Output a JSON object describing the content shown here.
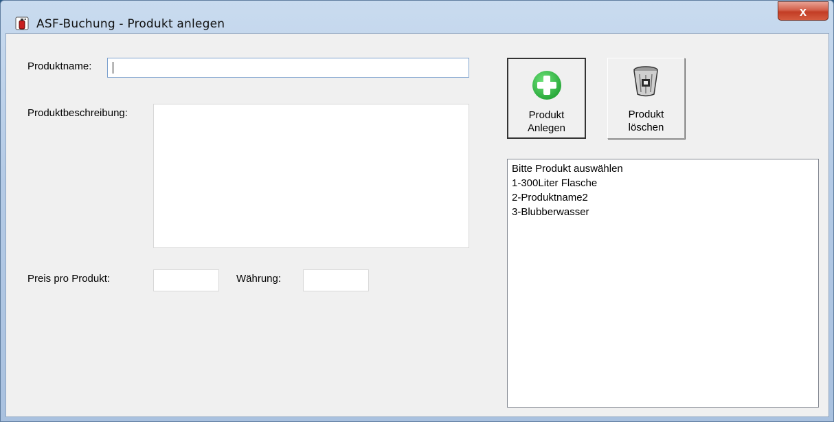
{
  "window": {
    "title": "ASF-Buchung - Produkt anlegen",
    "close_label": "x"
  },
  "form": {
    "name_label": "Produktname:",
    "description_label": "Produktbeschreibung:",
    "price_label": "Preis pro Produkt:",
    "currency_label": "Währung:"
  },
  "buttons": {
    "add_line1": "Produkt",
    "add_line2": "Anlegen",
    "delete_line1": "Produkt",
    "delete_line2": "löschen"
  },
  "product_list": {
    "items": [
      "Bitte Produkt auswählen",
      "1-300Liter Flasche",
      "2-Produktname2",
      "3-Blubberwasser"
    ]
  },
  "colors": {
    "add_icon": "#3bc14a",
    "close_button": "#c94a33",
    "client_bg": "#f0f0f0"
  },
  "icons": {
    "app": "fire-extinguisher-icon",
    "add": "plus-circle-icon",
    "delete": "trash-bin-icon"
  }
}
